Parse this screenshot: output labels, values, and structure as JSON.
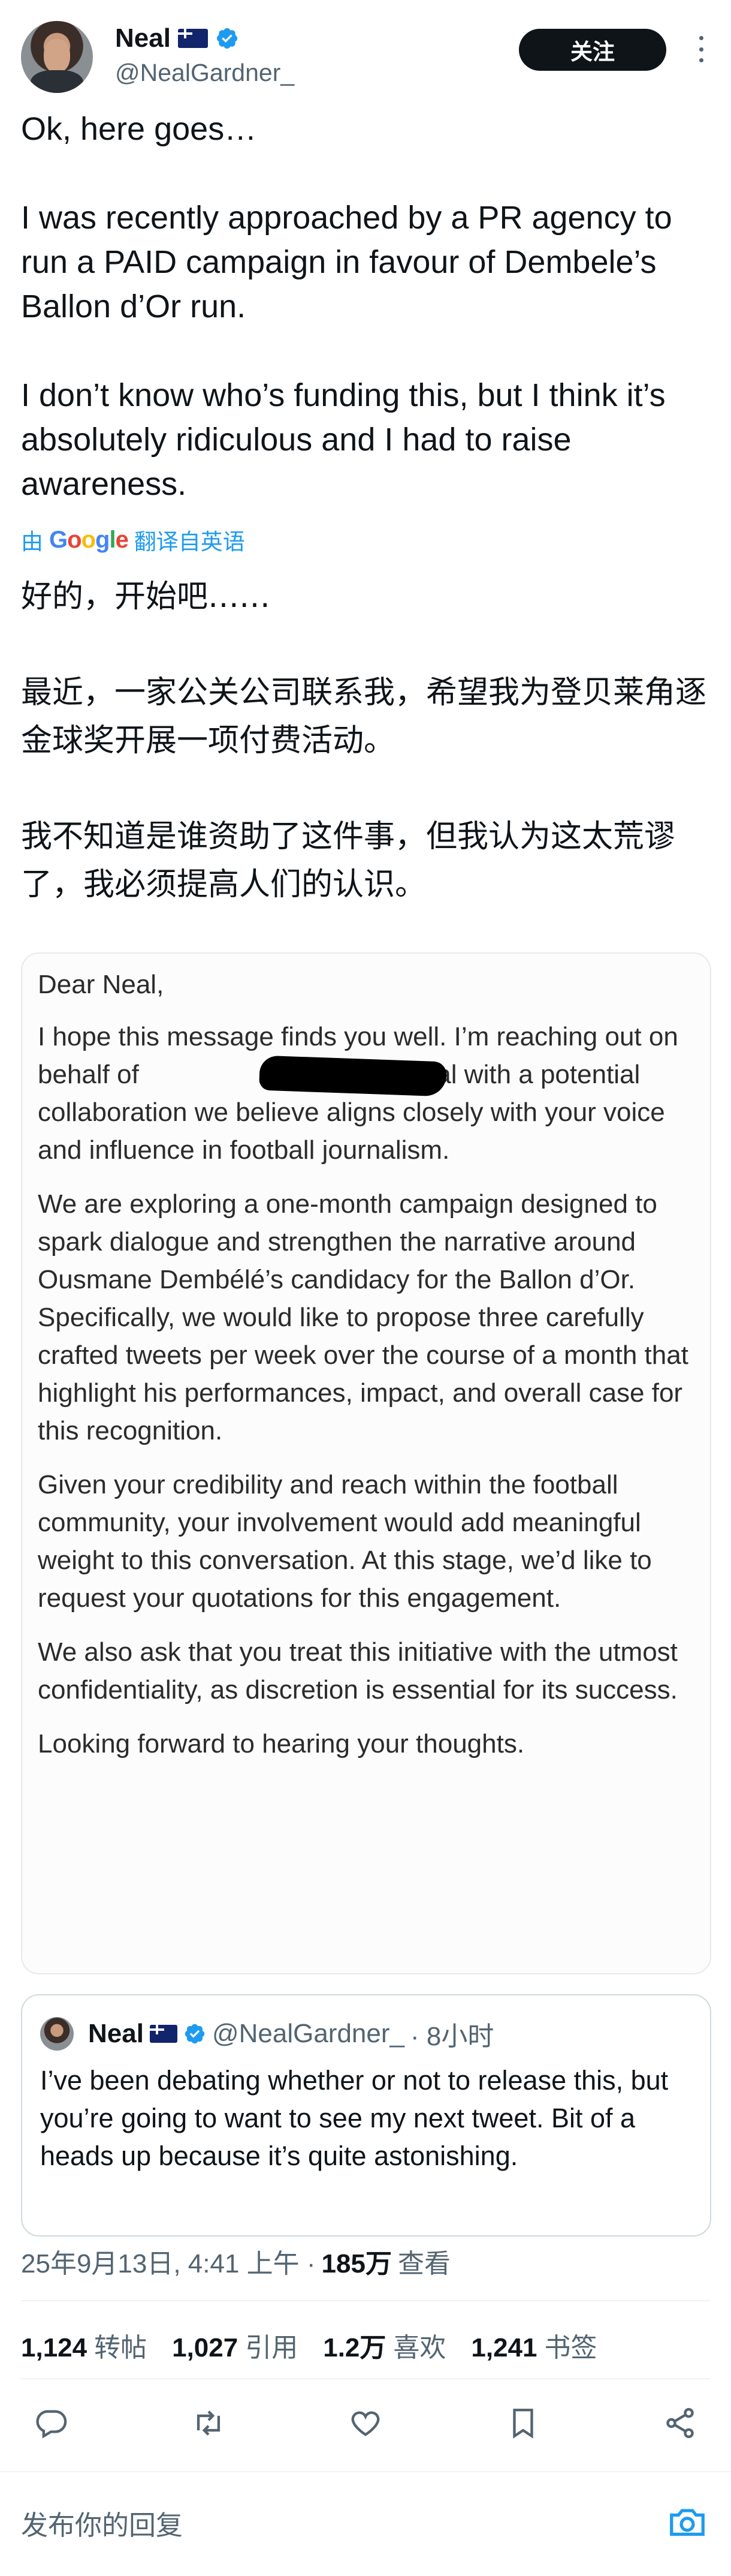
{
  "author": {
    "name": "Neal",
    "handle": "@NealGardner_",
    "flag": "australia-flag",
    "verified": true
  },
  "follow_label": "关注",
  "tweet": {
    "paragraphs": [
      "Ok, here goes…",
      "I was recently approached by a PR agency to run a PAID campaign in favour of Dembele’s Ballon d’Or run.",
      "I don’t know who’s funding this, but I think it’s absolutely ridiculous and I had to raise awareness."
    ]
  },
  "translation": {
    "prefix": "由",
    "brand": "Google",
    "suffix": "翻译自英语",
    "paragraphs": [
      "好的，开始吧……",
      "最近，一家公关公司联系我，希望我为登贝莱角逐金球奖开展一项付费活动。",
      "我不知道是谁资助了这件事，但我认为这太荒谬了，我必须提高人们的认识。"
    ]
  },
  "letter": {
    "salutation": "Dear Neal,",
    "paragraphs": [
      "I hope this message finds you well. I’m reaching out on behalf of [redacted] International with a potential collaboration we believe aligns closely with your voice and influence in football journalism.",
      "We are exploring a one-month campaign designed to spark dialogue and strengthen the narrative around Ousmane Dembélé’s candidacy for the Ballon d’Or. Specifically, we would like to propose three carefully crafted tweets per week over the course of a month that highlight his performances, impact, and overall case for this recognition.",
      "Given your credibility and reach within the football community, your involvement would add meaningful weight to this conversation. At this stage, we’d like to request your quotations for this engagement.",
      "We also ask that you treat this initiative with the utmost confidentiality, as discretion is essential for its success.",
      "Looking forward to hearing your thoughts."
    ]
  },
  "quote": {
    "name": "Neal",
    "handle": "@NealGardner_",
    "time": "· 8小时",
    "text": "I’ve been debating whether or not to release this, but you’re going to want to see my next tweet. Bit of a heads up because it’s quite astonishing."
  },
  "meta": {
    "datetime": "25年9月13日, 4:41 上午 ·",
    "views_value": "185万",
    "views_label": "查看"
  },
  "stats": [
    {
      "value": "1,124",
      "label": "转帖"
    },
    {
      "value": "1,027",
      "label": "引用"
    },
    {
      "value": "1.2万",
      "label": "喜欢"
    },
    {
      "value": "1,241",
      "label": "书签"
    }
  ],
  "actions": [
    "reply-icon",
    "retweet-icon",
    "like-icon",
    "bookmark-icon",
    "share-icon"
  ],
  "reply": {
    "placeholder": "发布你的回复"
  },
  "colors": {
    "accent": "#1d9bf0",
    "text": "#0f1419",
    "muted": "#536471"
  }
}
